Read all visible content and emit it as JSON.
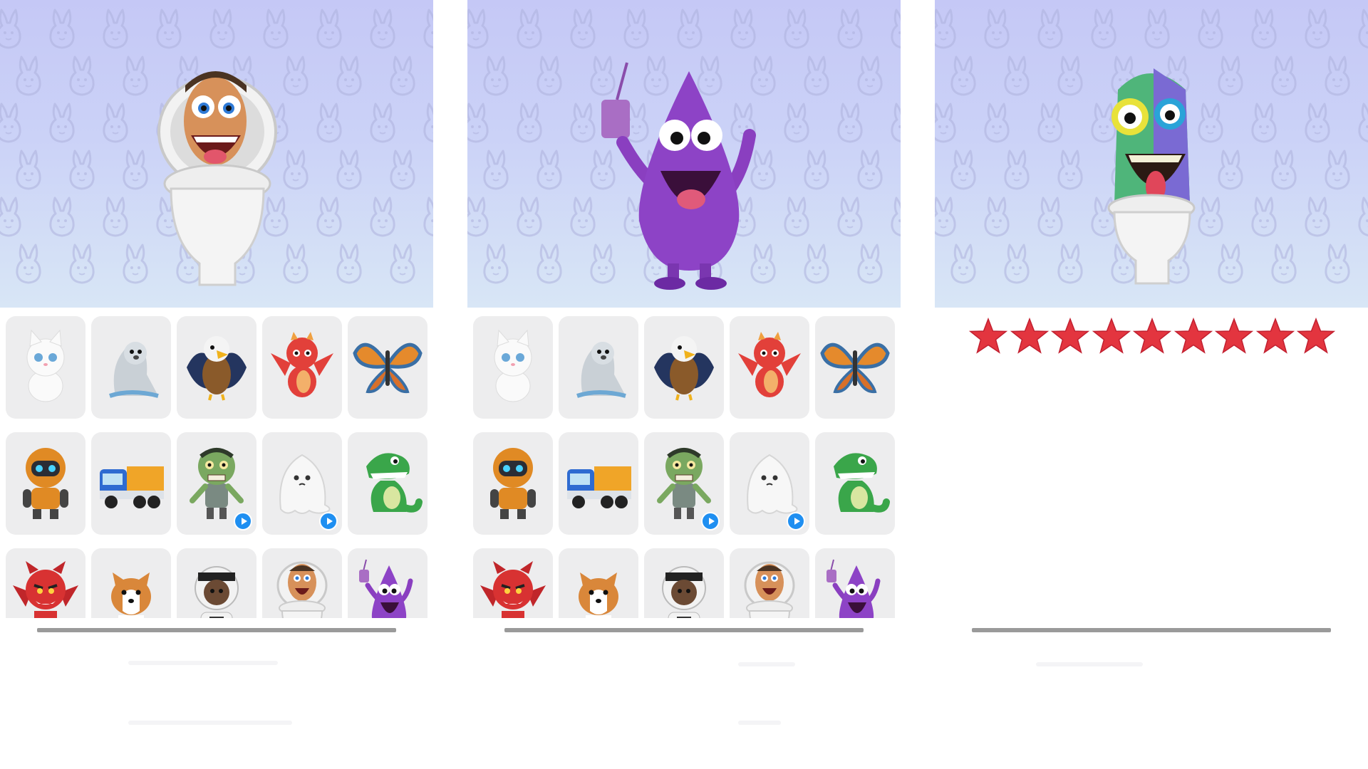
{
  "screens": [
    {
      "hero": {
        "character": "skibidi-toilet-man",
        "bg_top": "#c5c8f6",
        "bg_bottom": "#d8e6f6"
      },
      "grid": [
        {
          "icon": "white-cat",
          "video": false
        },
        {
          "icon": "seal",
          "video": false
        },
        {
          "icon": "eagle",
          "video": false
        },
        {
          "icon": "red-dragon",
          "video": false
        },
        {
          "icon": "butterfly",
          "video": false
        },
        {
          "icon": "orange-robot",
          "video": false
        },
        {
          "icon": "dump-truck",
          "video": false
        },
        {
          "icon": "zombie",
          "video": true
        },
        {
          "icon": "ghost",
          "video": true
        },
        {
          "icon": "green-dinosaur",
          "video": false
        },
        {
          "icon": "red-devil",
          "video": false
        },
        {
          "icon": "corgi-dog",
          "video": false
        },
        {
          "icon": "astronaut",
          "video": false
        },
        {
          "icon": "skibidi-toilet-man",
          "video": false
        },
        {
          "icon": "purple-grimace-blob",
          "video": false
        }
      ]
    },
    {
      "hero": {
        "character": "purple-grimace-blob",
        "bg_top": "#c5c8f6",
        "bg_bottom": "#d8e6f6"
      },
      "grid": [
        {
          "icon": "white-cat",
          "video": false
        },
        {
          "icon": "seal",
          "video": false
        },
        {
          "icon": "eagle",
          "video": false
        },
        {
          "icon": "red-dragon",
          "video": false
        },
        {
          "icon": "butterfly",
          "video": false
        },
        {
          "icon": "orange-robot",
          "video": false
        },
        {
          "icon": "dump-truck",
          "video": false
        },
        {
          "icon": "zombie",
          "video": true
        },
        {
          "icon": "ghost",
          "video": true
        },
        {
          "icon": "green-dinosaur",
          "video": false
        },
        {
          "icon": "red-devil",
          "video": false
        },
        {
          "icon": "corgi-dog",
          "video": false
        },
        {
          "icon": "astronaut",
          "video": false
        },
        {
          "icon": "skibidi-toilet-man",
          "video": false
        },
        {
          "icon": "purple-grimace-blob",
          "video": false
        }
      ]
    },
    {
      "hero": {
        "character": "rainbow-toilet-monster",
        "bg_top": "#c5c8f6",
        "bg_bottom": "#d8e6f6"
      },
      "rating": {
        "stars": 9,
        "star_color": "#e3353f"
      }
    }
  ],
  "colors": {
    "tile_bg": "#ededee",
    "play_badge": "#1f8ff1",
    "scrollbar": "#9a9a9a"
  }
}
